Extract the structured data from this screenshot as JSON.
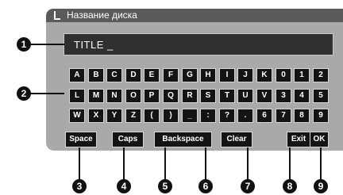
{
  "header": {
    "title": "Название диска"
  },
  "input": {
    "value": "TITLE _"
  },
  "keyboard": {
    "rows": [
      [
        "A",
        "B",
        "C",
        "D",
        "E",
        "F",
        "G",
        "H",
        "I",
        "J",
        "K",
        "0",
        "1",
        "2"
      ],
      [
        "L",
        "M",
        "N",
        "O",
        "P",
        "Q",
        "R",
        "S",
        "T",
        "U",
        "V",
        "3",
        "4",
        "5"
      ],
      [
        "W",
        "X",
        "Y",
        "Z",
        "(",
        ")",
        "_",
        ":",
        "?",
        ".",
        "6",
        "7",
        "8",
        "9"
      ]
    ]
  },
  "function_keys": [
    "Space",
    "Caps",
    "Backspace",
    "Clear",
    "Exit",
    "OK"
  ],
  "callouts": [
    "1",
    "2",
    "3",
    "4",
    "5",
    "6",
    "7",
    "8",
    "9"
  ]
}
